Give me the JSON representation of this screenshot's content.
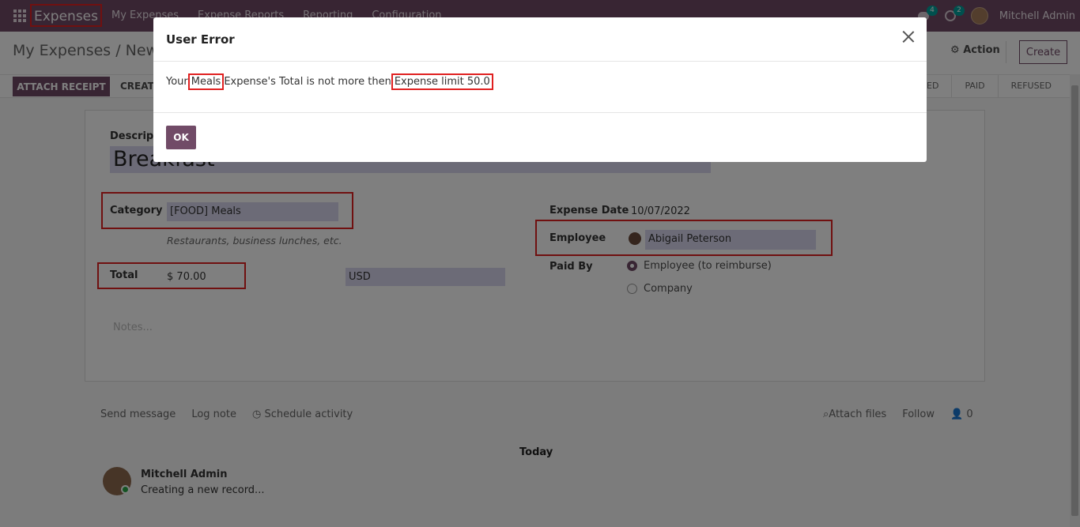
{
  "navbar": {
    "brand": "Expenses",
    "menu": [
      "My Expenses",
      "Expense Reports",
      "Reporting",
      "Configuration"
    ],
    "chat_count": "4",
    "activity_count": "2",
    "user_name": "Mitchell Admin"
  },
  "control_panel": {
    "breadcrumb_parent": "My Expenses",
    "breadcrumb_sep": "/",
    "breadcrumb_current": "New",
    "action_label": "Action",
    "create_label": "Create"
  },
  "statusbar": {
    "attach_receipt": "ATTACH RECEIPT",
    "create_report": "CREATE REPORT",
    "stages": [
      "APPROVED",
      "PAID",
      "REFUSED"
    ]
  },
  "form": {
    "description_label": "Description",
    "description_value": "Breakfast",
    "category_label": "Category",
    "category_value": "[FOOD] Meals",
    "category_hint": "Restaurants, business lunches, etc.",
    "total_label": "Total",
    "total_currency_symbol": "$",
    "total_value": "70.00",
    "currency_value": "USD",
    "expense_date_label": "Expense Date",
    "expense_date_value": "10/07/2022",
    "employee_label": "Employee",
    "employee_value": "Abigail Peterson",
    "paid_by_label": "Paid By",
    "paid_by_options": [
      "Employee (to reimburse)",
      "Company"
    ],
    "notes_placeholder": "Notes..."
  },
  "chatter": {
    "send_message": "Send message",
    "log_note": "Log note",
    "schedule_activity": "Schedule activity",
    "attach_files": "Attach files",
    "follow": "Follow",
    "followers_count": "0",
    "date_separator": "Today",
    "message_author": "Mitchell Admin",
    "message_body": "Creating a new record..."
  },
  "dialog": {
    "title": "User Error",
    "message_prefix": "Your",
    "message_category": "Meals",
    "message_middle": "Expense's Total is not more then",
    "message_limit": "Expense limit 50.0",
    "ok_label": "OK"
  },
  "colors": {
    "brand": "#714b67",
    "highlight": "#e02020",
    "field_bg": "#d8d7ef"
  }
}
